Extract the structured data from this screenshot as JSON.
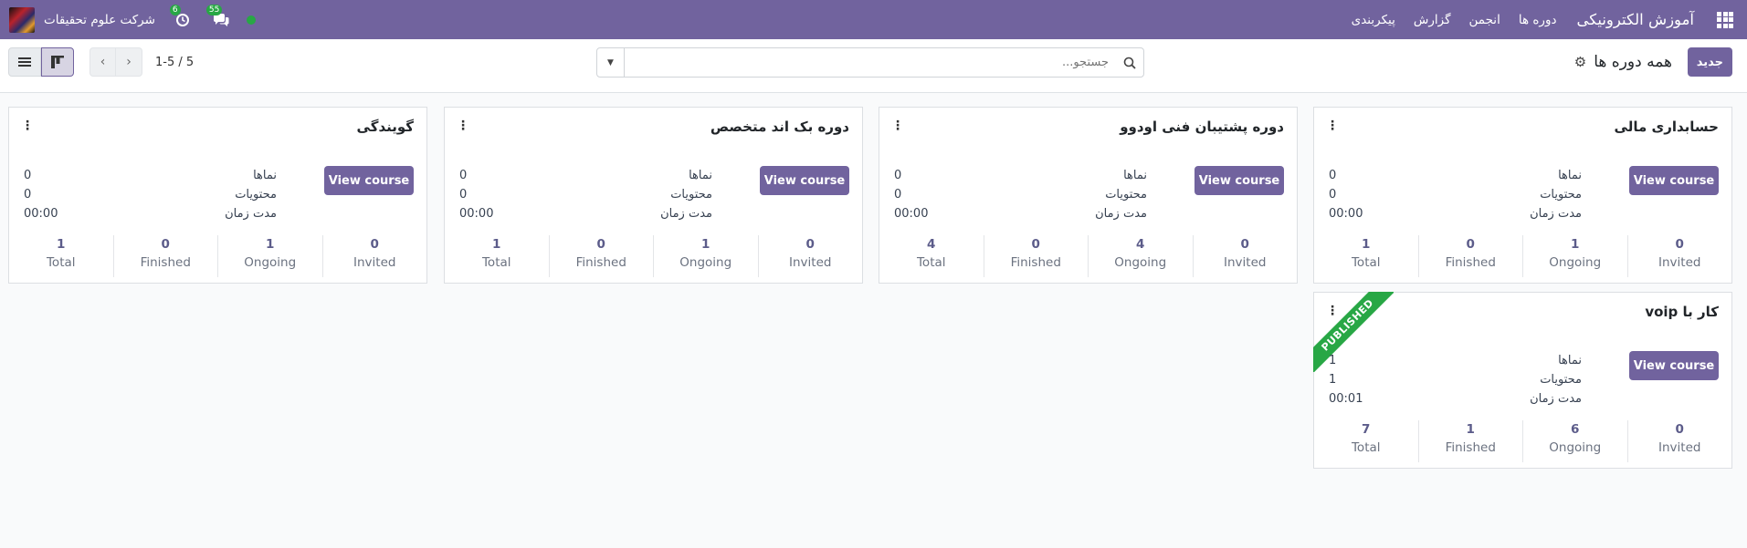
{
  "navbar": {
    "brand": "آموزش الکترونیکی",
    "menu": [
      "دوره ها",
      "انجمن",
      "گزارش",
      "پیکربندی"
    ],
    "company": "شرکت علوم تحقیقات",
    "messages_count": "55",
    "activities_count": "6"
  },
  "control": {
    "new_button": "جدید",
    "breadcrumb": "همه دوره ها",
    "search_placeholder": "جستجو...",
    "pager_value": "1-5 / 5"
  },
  "labels": {
    "views": "نماها",
    "contents": "محتویات",
    "duration": "مدت زمان",
    "view_course": "View course",
    "invited": "Invited",
    "ongoing": "Ongoing",
    "finished": "Finished",
    "total": "Total",
    "published": "PUBLISHED"
  },
  "courses": [
    {
      "title": "حسابداری مالی",
      "views": "0",
      "contents": "0",
      "duration": "00:00",
      "invited": "0",
      "ongoing": "1",
      "finished": "0",
      "total": "1",
      "published": false
    },
    {
      "title": "دوره پشتیبان فنی اودوو",
      "views": "0",
      "contents": "0",
      "duration": "00:00",
      "invited": "0",
      "ongoing": "4",
      "finished": "0",
      "total": "4",
      "published": false
    },
    {
      "title": "دوره بک اند متخصص",
      "views": "0",
      "contents": "0",
      "duration": "00:00",
      "invited": "0",
      "ongoing": "1",
      "finished": "0",
      "total": "1",
      "published": false
    },
    {
      "title": "گویندگی",
      "views": "0",
      "contents": "0",
      "duration": "00:00",
      "invited": "0",
      "ongoing": "1",
      "finished": "0",
      "total": "1",
      "published": false
    },
    {
      "title": "کار با voip",
      "views": "1",
      "contents": "1",
      "duration": "00:01",
      "invited": "0",
      "ongoing": "6",
      "finished": "1",
      "total": "7",
      "published": true
    }
  ],
  "colors": {
    "primary": "#71639e",
    "success": "#28a745"
  }
}
